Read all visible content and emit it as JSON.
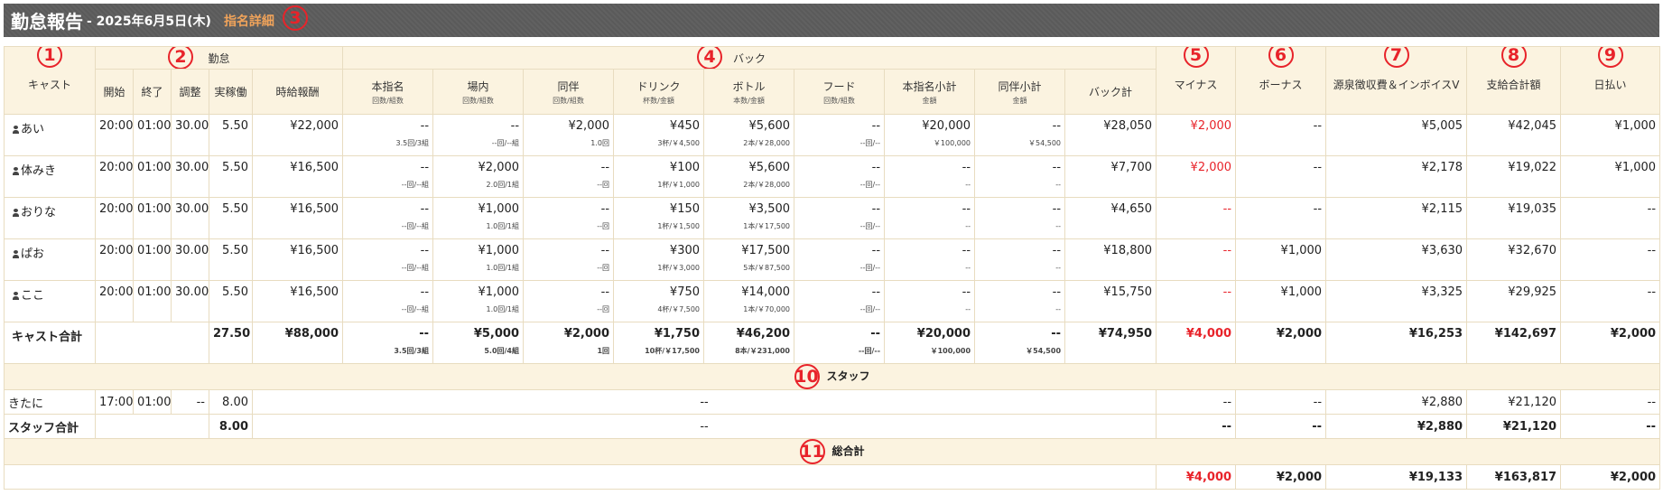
{
  "title": {
    "main": "勤怠報告",
    "date": "- 2025年6月5日(木)",
    "link": "指名詳細",
    "circle": "3"
  },
  "header": {
    "cast": {
      "label": "キャスト",
      "circle": "1"
    },
    "attendance": {
      "label": "勤怠",
      "circle": "2"
    },
    "back": {
      "label": "バック",
      "circle": "4"
    },
    "minus": {
      "label": "マイナス",
      "circle": "5"
    },
    "bonus": {
      "label": "ボーナス",
      "circle": "6"
    },
    "tax": {
      "label": "源泉徴収費＆インボイスV",
      "circle": "7"
    },
    "total_pay": {
      "label": "支給合計額",
      "circle": "8"
    },
    "daily": {
      "label": "日払い",
      "circle": "9"
    },
    "start": "開始",
    "end": "終了",
    "adjust": "調整",
    "worked": "実稼働",
    "hourly": "時給報酬",
    "honshimei": {
      "label": "本指名",
      "sub": "回数/組数"
    },
    "jonai": {
      "label": "場内",
      "sub": "回数/組数"
    },
    "douhan": {
      "label": "同伴",
      "sub": "回数/組数"
    },
    "drink": {
      "label": "ドリンク",
      "sub": "杯数/金額"
    },
    "bottle": {
      "label": "ボトル",
      "sub": "本数/金額"
    },
    "food": {
      "label": "フード",
      "sub": "回数/組数"
    },
    "honshimei_sub": {
      "label": "本指名小計",
      "sub": "金額"
    },
    "douhan_sub": {
      "label": "同伴小計",
      "sub": "金額"
    },
    "back_total": "バック計"
  },
  "casts": [
    {
      "name": "あい",
      "start": "20:00",
      "end": "01:00",
      "adjust": "30.00",
      "worked": "5.50",
      "hourly": "¥22,000",
      "honshimei": "--",
      "honshimei_s": "3.5回/3組",
      "jonai": "--",
      "jonai_s": "--回/--組",
      "douhan": "¥2,000",
      "douhan_s": "1.0回",
      "drink": "¥450",
      "drink_s": "3杯/￥4,500",
      "bottle": "¥5,600",
      "bottle_s": "2本/￥28,000",
      "food": "--",
      "food_s": "--回/--",
      "hs_sub": "¥20,000",
      "hs_sub_s": "￥100,000",
      "dh_sub": "--",
      "dh_sub_s": "￥54,500",
      "back_total": "¥28,050",
      "minus": "¥2,000",
      "bonus": "--",
      "tax": "¥5,005",
      "total": "¥42,045",
      "daily": "¥1,000"
    },
    {
      "name": "体みき",
      "start": "20:00",
      "end": "01:00",
      "adjust": "30.00",
      "worked": "5.50",
      "hourly": "¥16,500",
      "honshimei": "--",
      "honshimei_s": "--回/--組",
      "jonai": "¥2,000",
      "jonai_s": "2.0回/1組",
      "douhan": "--",
      "douhan_s": "--回",
      "drink": "¥100",
      "drink_s": "1杯/￥1,000",
      "bottle": "¥5,600",
      "bottle_s": "2本/￥28,000",
      "food": "--",
      "food_s": "--回/--",
      "hs_sub": "--",
      "hs_sub_s": "--",
      "dh_sub": "--",
      "dh_sub_s": "--",
      "back_total": "¥7,700",
      "minus": "¥2,000",
      "bonus": "--",
      "tax": "¥2,178",
      "total": "¥19,022",
      "daily": "¥1,000"
    },
    {
      "name": "おりな",
      "start": "20:00",
      "end": "01:00",
      "adjust": "30.00",
      "worked": "5.50",
      "hourly": "¥16,500",
      "honshimei": "--",
      "honshimei_s": "--回/--組",
      "jonai": "¥1,000",
      "jonai_s": "1.0回/1組",
      "douhan": "--",
      "douhan_s": "--回",
      "drink": "¥150",
      "drink_s": "1杯/￥1,500",
      "bottle": "¥3,500",
      "bottle_s": "1本/￥17,500",
      "food": "--",
      "food_s": "--回/--",
      "hs_sub": "--",
      "hs_sub_s": "--",
      "dh_sub": "--",
      "dh_sub_s": "--",
      "back_total": "¥4,650",
      "minus": "--",
      "bonus": "--",
      "tax": "¥2,115",
      "total": "¥19,035",
      "daily": "--"
    },
    {
      "name": "ぱお",
      "start": "20:00",
      "end": "01:00",
      "adjust": "30.00",
      "worked": "5.50",
      "hourly": "¥16,500",
      "honshimei": "--",
      "honshimei_s": "--回/--組",
      "jonai": "¥1,000",
      "jonai_s": "1.0回/1組",
      "douhan": "--",
      "douhan_s": "--回",
      "drink": "¥300",
      "drink_s": "1杯/￥3,000",
      "bottle": "¥17,500",
      "bottle_s": "5本/￥87,500",
      "food": "--",
      "food_s": "--回/--",
      "hs_sub": "--",
      "hs_sub_s": "--",
      "dh_sub": "--",
      "dh_sub_s": "--",
      "back_total": "¥18,800",
      "minus": "--",
      "bonus": "¥1,000",
      "tax": "¥3,630",
      "total": "¥32,670",
      "daily": "--"
    },
    {
      "name": "ここ",
      "start": "20:00",
      "end": "01:00",
      "adjust": "30.00",
      "worked": "5.50",
      "hourly": "¥16,500",
      "honshimei": "--",
      "honshimei_s": "--回/--組",
      "jonai": "¥1,000",
      "jonai_s": "1.0回/1組",
      "douhan": "--",
      "douhan_s": "--回",
      "drink": "¥750",
      "drink_s": "4杯/￥7,500",
      "bottle": "¥14,000",
      "bottle_s": "1本/￥70,000",
      "food": "--",
      "food_s": "--回/--",
      "hs_sub": "--",
      "hs_sub_s": "--",
      "dh_sub": "--",
      "dh_sub_s": "--",
      "back_total": "¥15,750",
      "minus": "--",
      "bonus": "¥1,000",
      "tax": "¥3,325",
      "total": "¥29,925",
      "daily": "--"
    }
  ],
  "cast_total": {
    "label": "キャスト合計",
    "worked": "27.50",
    "hourly": "¥88,000",
    "honshimei": "--",
    "honshimei_s": "3.5回/3組",
    "jonai": "¥5,000",
    "jonai_s": "5.0回/4組",
    "douhan": "¥2,000",
    "douhan_s": "1回",
    "drink": "¥1,750",
    "drink_s": "10杯/￥17,500",
    "bottle": "¥46,200",
    "bottle_s": "8本/￥231,000",
    "food": "--",
    "food_s": "--回/--",
    "hs_sub": "¥20,000",
    "hs_sub_s": "￥100,000",
    "dh_sub": "--",
    "dh_sub_s": "￥54,500",
    "back_total": "¥74,950",
    "minus": "¥4,000",
    "bonus": "¥2,000",
    "tax": "¥16,253",
    "total": "¥142,697",
    "daily": "¥2,000"
  },
  "staff_section": {
    "label": "スタッフ",
    "circle": "10"
  },
  "staff": [
    {
      "name": "きたに",
      "start": "17:00",
      "end": "01:00",
      "adjust": "--",
      "worked": "8.00",
      "back": "--",
      "minus": "--",
      "bonus": "--",
      "tax": "¥2,880",
      "total": "¥21,120",
      "daily": "--"
    }
  ],
  "staff_total": {
    "label": "スタッフ合計",
    "worked": "8.00",
    "back": "--",
    "minus": "--",
    "bonus": "--",
    "tax": "¥2,880",
    "total": "¥21,120",
    "daily": "--"
  },
  "grand_section": {
    "label": "総合計",
    "circle": "11"
  },
  "grand_total": {
    "minus": "¥4,000",
    "bonus": "¥2,000",
    "tax": "¥19,133",
    "total": "¥163,817",
    "daily": "¥2,000"
  },
  "colors": {
    "accent_red": "#e8232a",
    "header_bg": "#fbf3e0",
    "title_bar": "#5e5e5e",
    "link": "#f0a35a"
  }
}
